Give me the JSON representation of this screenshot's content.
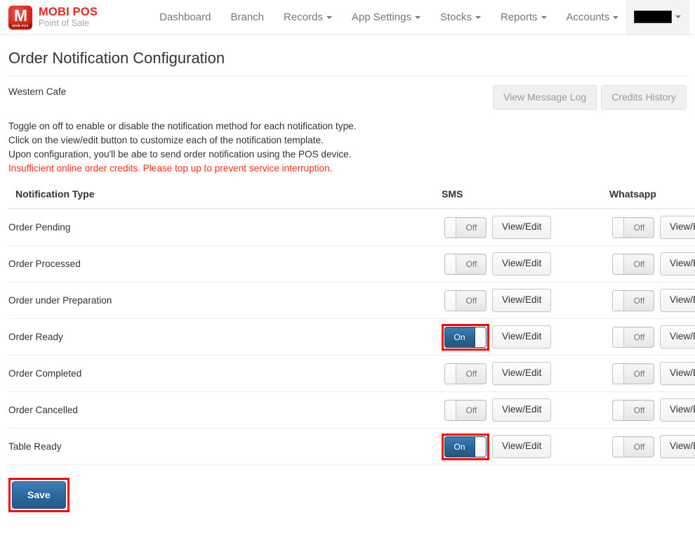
{
  "brand": {
    "logo_mark": "M",
    "logo_badge": "MOBI POS",
    "title": "MOBI POS",
    "subtitle": "Point of Sale",
    "brand_color": "#e8281e"
  },
  "navbar": {
    "items": [
      {
        "label": "Dashboard",
        "has_caret": false
      },
      {
        "label": "Branch",
        "has_caret": false
      },
      {
        "label": "Records",
        "has_caret": true
      },
      {
        "label": "App Settings",
        "has_caret": true
      },
      {
        "label": "Stocks",
        "has_caret": true
      },
      {
        "label": "Reports",
        "has_caret": true
      },
      {
        "label": "Accounts",
        "has_caret": true
      }
    ],
    "user": {
      "name": "",
      "redacted": true,
      "has_caret": true
    }
  },
  "page": {
    "title": "Order Notification Configuration",
    "branch_name": "Western Cafe"
  },
  "actions": {
    "view_message_log": "View Message Log",
    "credits_history": "Credits History"
  },
  "instructions": {
    "line1": "Toggle on off to enable or disable the notification method for each notification type.",
    "line2": "Click on the view/edit button to customize each of the notification template.",
    "line3": "Upon configuration, you'll be abe to send order notification using the POS device.",
    "warning": "Insufficient online order credits. Please top up to prevent service interruption.",
    "warning_color": "#ff2d18"
  },
  "table": {
    "headers": {
      "type": "Notification Type",
      "sms": "SMS",
      "whatsapp": "Whatsapp"
    },
    "toggle_on_label": "On",
    "toggle_off_label": "Off",
    "view_edit_label": "View/Edit",
    "rows": [
      {
        "type": "Order Pending",
        "sms": "Off",
        "sms_on": false,
        "sms_highlighted": false,
        "wa": "Off",
        "wa_on": false,
        "wa_highlighted": false
      },
      {
        "type": "Order Processed",
        "sms": "Off",
        "sms_on": false,
        "sms_highlighted": false,
        "wa": "Off",
        "wa_on": false,
        "wa_highlighted": false
      },
      {
        "type": "Order under Preparation",
        "sms": "Off",
        "sms_on": false,
        "sms_highlighted": false,
        "wa": "Off",
        "wa_on": false,
        "wa_highlighted": false
      },
      {
        "type": "Order Ready",
        "sms": "On",
        "sms_on": true,
        "sms_highlighted": true,
        "wa": "Off",
        "wa_on": false,
        "wa_highlighted": false
      },
      {
        "type": "Order Completed",
        "sms": "Off",
        "sms_on": false,
        "sms_highlighted": false,
        "wa": "Off",
        "wa_on": false,
        "wa_highlighted": false
      },
      {
        "type": "Order Cancelled",
        "sms": "Off",
        "sms_on": false,
        "sms_highlighted": false,
        "wa": "Off",
        "wa_on": false,
        "wa_highlighted": false
      },
      {
        "type": "Table Ready",
        "sms": "On",
        "sms_on": true,
        "sms_highlighted": true,
        "wa": "Off",
        "wa_on": false,
        "wa_highlighted": false
      }
    ]
  },
  "footer": {
    "save_label": "Save",
    "save_highlighted": true,
    "highlight_color": "#ff0000",
    "accent_color": "#2d6ca2"
  }
}
